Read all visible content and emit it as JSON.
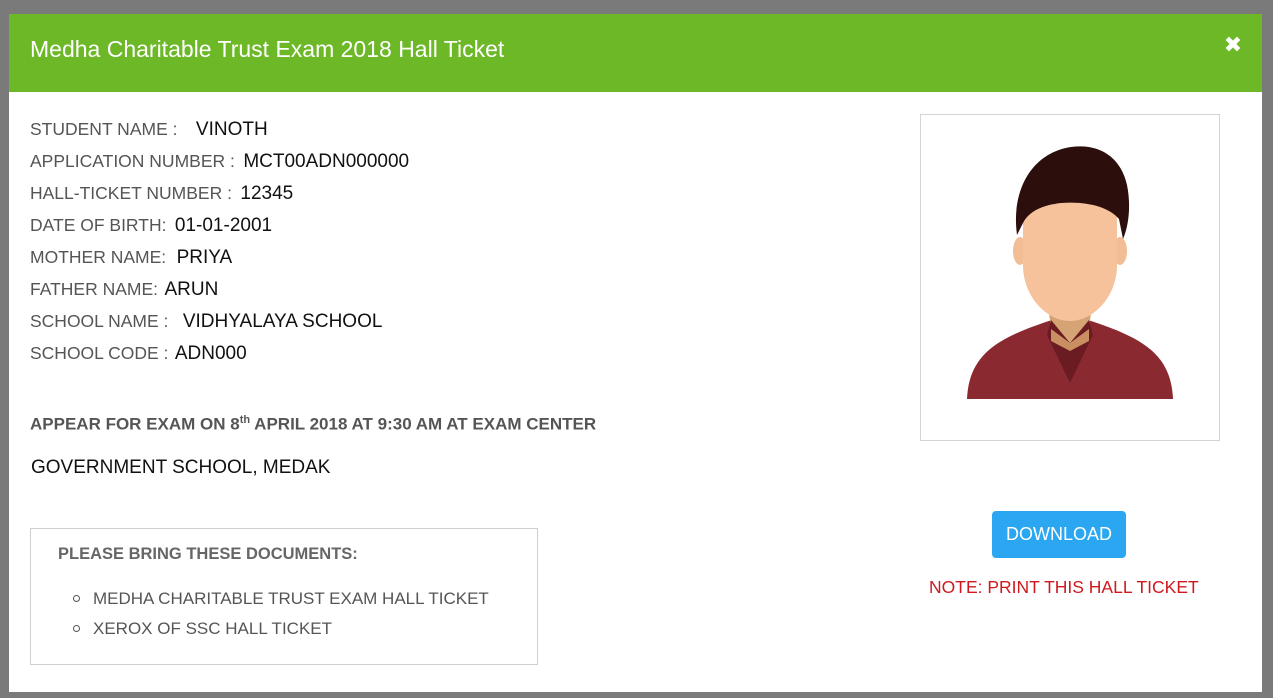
{
  "modal": {
    "title": "Medha Charitable Trust Exam 2018 Hall Ticket",
    "close_icon": "close-icon",
    "close_symbol": "✖"
  },
  "student": {
    "fields": [
      {
        "label": "STUDENT NAME :",
        "value": "VINOTH"
      },
      {
        "label": "APPLICATION NUMBER :",
        "value": "MCT00ADN000000"
      },
      {
        "label": "HALL-TICKET NUMBER :",
        "value": "12345"
      },
      {
        "label": "DATE OF BIRTH:",
        "value": "01-01-2001"
      },
      {
        "label": "MOTHER NAME:",
        "value": "PRIYA"
      },
      {
        "label": "FATHER NAME:",
        "value": "ARUN"
      },
      {
        "label": "SCHOOL NAME :",
        "value": "VIDHYALAYA SCHOOL"
      },
      {
        "label": "SCHOOL CODE :",
        "value": "ADN000"
      }
    ]
  },
  "exam": {
    "prefix": "APPEAR FOR EXAM ON 8",
    "superscript": "th",
    "suffix": " APRIL 2018 AT 9:30 AM AT EXAM CENTER",
    "center": "GOVERNMENT SCHOOL, MEDAK"
  },
  "documents": {
    "heading": "PLEASE BRING THESE DOCUMENTS:",
    "items": [
      "MEDHA CHARITABLE TRUST EXAM HALL TICKET",
      "XEROX OF SSC HALL TICKET"
    ]
  },
  "photo": {
    "icon": "avatar-placeholder"
  },
  "actions": {
    "download_label": "DOWNLOAD",
    "note": "NOTE: PRINT THIS HALL TICKET"
  },
  "colors": {
    "header": "#6cb827",
    "button": "#2aa7f0",
    "note": "#d0181f"
  }
}
